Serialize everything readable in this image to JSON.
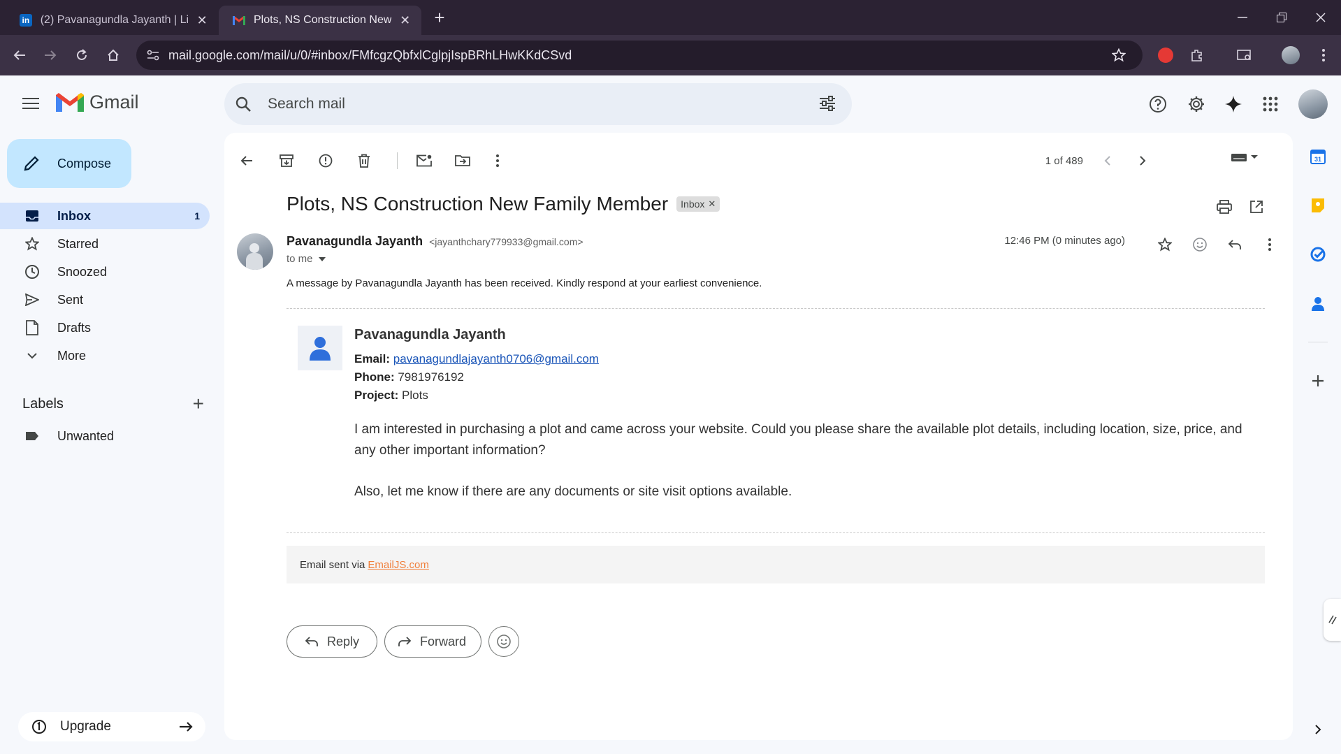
{
  "browser": {
    "tabs": [
      {
        "title": "(2) Pavanagundla Jayanth | LinkedIn",
        "favicon": "linkedin-icon",
        "active": false
      },
      {
        "title": "Plots, NS Construction New Family Member",
        "favicon": "gmail-icon",
        "active": true
      }
    ],
    "url": "mail.google.com/mail/u/0/#inbox/FMfcgzQbfxlCglpjIspBRhLHwKKdCSvd"
  },
  "gmail": {
    "brand": "Gmail",
    "search_placeholder": "Search mail",
    "compose_label": "Compose",
    "nav": [
      {
        "label": "Inbox",
        "count": "1",
        "icon": "inbox-icon",
        "active": true
      },
      {
        "label": "Starred",
        "count": "",
        "icon": "star-icon",
        "active": false
      },
      {
        "label": "Snoozed",
        "count": "",
        "icon": "clock-icon",
        "active": false
      },
      {
        "label": "Sent",
        "count": "",
        "icon": "send-icon",
        "active": false
      },
      {
        "label": "Drafts",
        "count": "",
        "icon": "draft-icon",
        "active": false
      },
      {
        "label": "More",
        "count": "",
        "icon": "chevron-down-icon",
        "active": false
      }
    ],
    "labels_heading": "Labels",
    "labels": [
      {
        "label": "Unwanted",
        "icon": "label-icon"
      }
    ],
    "upgrade_label": "Upgrade"
  },
  "toolbar": {
    "pager": "1 of 489"
  },
  "email": {
    "subject": "Plots, NS Construction New Family Member",
    "badge": "Inbox",
    "sender_name": "Pavanagundla Jayanth",
    "sender_email": "<jayanthchary779933@gmail.com>",
    "to": "to me",
    "time": "12:46 PM (0 minutes ago)",
    "preview": "A message by Pavanagundla Jayanth has been received. Kindly respond at your earliest convenience.",
    "card": {
      "name": "Pavanagundla Jayanth",
      "email_label": "Email:",
      "email_value": "pavanagundlajayanth0706@gmail.com",
      "phone_label": "Phone:",
      "phone_value": "7981976192",
      "project_label": "Project:",
      "project_value": "Plots"
    },
    "body_p1": "I am interested in purchasing a plot and came across your website. Could you please share the available plot details, including location, size, price, and any other important information?",
    "body_p2": "Also, let me know if there are any documents or site visit options available.",
    "footer_prefix": "Email sent via",
    "footer_link": "EmailJS.com",
    "reply_label": "Reply",
    "forward_label": "Forward"
  },
  "colors": {
    "accent": "#0b57d0",
    "inbox_active_bg": "#d3e3fd",
    "compose_bg": "#c2e7ff",
    "link_orange": "#f0803c"
  }
}
